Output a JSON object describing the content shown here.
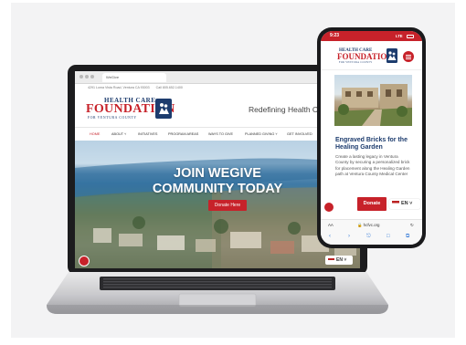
{
  "laptop": {
    "browser": {
      "tab_title": "WeGive"
    },
    "info_bar": {
      "address": "4291 Loma Vista Road, Ventura CA 93003",
      "phone": "Call 805.652.1400"
    },
    "logo": {
      "line1": "HEALTH CARE",
      "line2": "FOUNDATION",
      "line3": "FOR VENTURA COUNTY"
    },
    "tagline": "Redefining Health Ca",
    "nav": [
      {
        "label": "HOME"
      },
      {
        "label": "ABOUT ˅"
      },
      {
        "label": "INITIATIVES"
      },
      {
        "label": "PROGRAM AREAS"
      },
      {
        "label": "WAYS TO GIVE"
      },
      {
        "label": "PLANNED GIVING ˅"
      },
      {
        "label": "GET INVOLVED"
      }
    ],
    "hero": {
      "line1": "JOIN WEGIVE",
      "line2": "COMMUNITY TODAY",
      "button": "Donate Here"
    },
    "language": "EN ˅"
  },
  "phone": {
    "status": {
      "time": "9:23",
      "signal": "LTE"
    },
    "logo": {
      "line1": "HEALTH CARE",
      "line2": "FOUNDATION",
      "line3": "FOR VENTURA COUNTY"
    },
    "card": {
      "title": "Engraved Bricks for the Healing Garden",
      "body": "Create a lasting legacy in Ventura County by securing a personalized brick for placement along the Healing Garden path at Ventura County Medical Center"
    },
    "donate": "Donate",
    "language": "EN ˅",
    "address_bar": {
      "aa": "AA",
      "url": "🔒 hcfvc.org",
      "reload": "↻"
    },
    "toolbar": [
      "‹",
      "›",
      "⎋",
      "□",
      "⧉"
    ]
  },
  "colors": {
    "brand_red": "#c7222a",
    "brand_navy": "#1d3c6e"
  }
}
